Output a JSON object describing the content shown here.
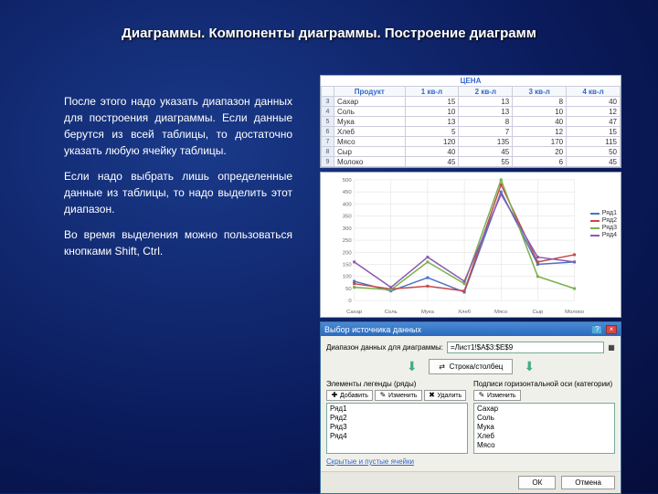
{
  "title": "Диаграммы. Компоненты диаграммы. Построение диаграмм",
  "paragraphs": [
    "После этого надо указать диапазон данных для построения диаграммы. Если данные берутся из всей таблицы, то достаточно указать любую ячейку таблицы.",
    "Если надо выбрать лишь определенные данные из таблицы, то надо выделить этот диапазон.",
    "Во время выделения можно пользоваться кнопками Shift, Ctrl."
  ],
  "spreadsheet": {
    "title": "ЦЕНА",
    "headers": [
      "Продукт",
      "1 кв-л",
      "2 кв-л",
      "3 кв-л",
      "4 кв-л"
    ],
    "rows": [
      {
        "n": 3,
        "cells": [
          "Сахар",
          "15",
          "13",
          "8",
          "40"
        ]
      },
      {
        "n": 4,
        "cells": [
          "Соль",
          "10",
          "13",
          "10",
          "12"
        ]
      },
      {
        "n": 5,
        "cells": [
          "Мука",
          "13",
          "8",
          "40",
          "47"
        ]
      },
      {
        "n": 6,
        "cells": [
          "Хлеб",
          "5",
          "7",
          "12",
          "15"
        ]
      },
      {
        "n": 7,
        "cells": [
          "Мясо",
          "120",
          "135",
          "170",
          "115"
        ]
      },
      {
        "n": 8,
        "cells": [
          "Сыр",
          "40",
          "45",
          "20",
          "50"
        ]
      },
      {
        "n": 9,
        "cells": [
          "Молоко",
          "45",
          "55",
          "6",
          "45"
        ]
      }
    ]
  },
  "chart_data": {
    "type": "line",
    "title": "",
    "xlabel": "",
    "ylabel": "",
    "ylim": [
      0,
      500
    ],
    "yticks": [
      0,
      50,
      100,
      150,
      200,
      250,
      300,
      350,
      400,
      450,
      500
    ],
    "categories": [
      "Сахар",
      "Соль",
      "Мука",
      "Хлеб",
      "Мясо",
      "Сыр",
      "Молоко"
    ],
    "series": [
      {
        "name": "Ряд1",
        "color": "#4a72c4",
        "values": [
          80,
          40,
          95,
          35,
          450,
          150,
          160
        ]
      },
      {
        "name": "Ряд2",
        "color": "#c44a4a",
        "values": [
          70,
          48,
          60,
          40,
          480,
          160,
          190
        ]
      },
      {
        "name": "Ряд3",
        "color": "#7ab04a",
        "values": [
          55,
          45,
          160,
          70,
          500,
          100,
          50
        ]
      },
      {
        "name": "Ряд4",
        "color": "#8a5ab0",
        "values": [
          160,
          55,
          180,
          80,
          440,
          180,
          160
        ]
      }
    ]
  },
  "dialog": {
    "title": "Выбор источника данных",
    "range_label": "Диапазон данных для диаграммы:",
    "range_value": "=Лист1!$A$3:$E$9",
    "swap_btn": "Строка/столбец",
    "left_header": "Элементы легенды (ряды)",
    "right_header": "Подписи горизонтальной оси (категории)",
    "btn_add": "Добавить",
    "btn_edit": "Изменить",
    "btn_del": "Удалить",
    "btn_edit2": "Изменить",
    "left_list": [
      "Ряд1",
      "Ряд2",
      "Ряд3",
      "Ряд4"
    ],
    "right_list": [
      "Сахар",
      "Соль",
      "Мука",
      "Хлеб",
      "Мясо"
    ],
    "link": "Скрытые и пустые ячейки",
    "ok": "ОК",
    "cancel": "Отмена"
  }
}
